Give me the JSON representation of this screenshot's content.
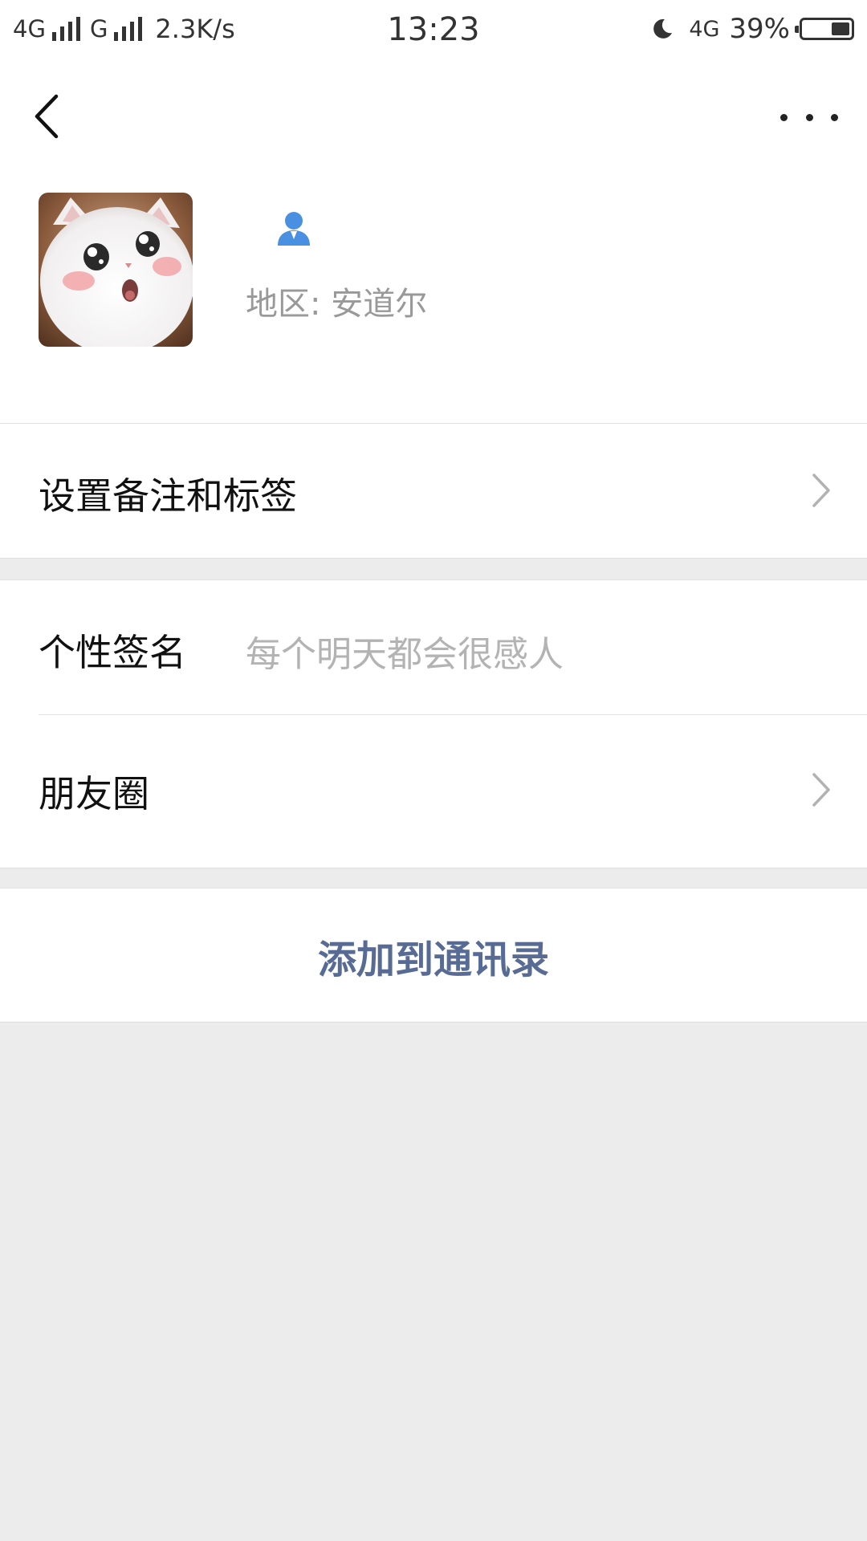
{
  "status_bar": {
    "network_1": "4G",
    "network_2": "G",
    "speed": "2.3K/s",
    "time": "13:23",
    "network_right": "4G",
    "battery_percent": "39%",
    "battery_level": 0.39
  },
  "nav": {
    "back_icon": "chevron-left-icon",
    "more_icon": "more-dots-icon"
  },
  "profile": {
    "avatar": "cat-avatar",
    "gender_icon": "person-icon",
    "gender_color": "#4a90e2",
    "region": "地区:  安道尔"
  },
  "rows": {
    "remark": "设置备注和标签",
    "signature_label": "个性签名",
    "signature_value": "每个明天都会很感人",
    "moments": "朋友圈"
  },
  "actions": {
    "add_contact": "添加到通讯录",
    "link_color": "#576b95"
  }
}
